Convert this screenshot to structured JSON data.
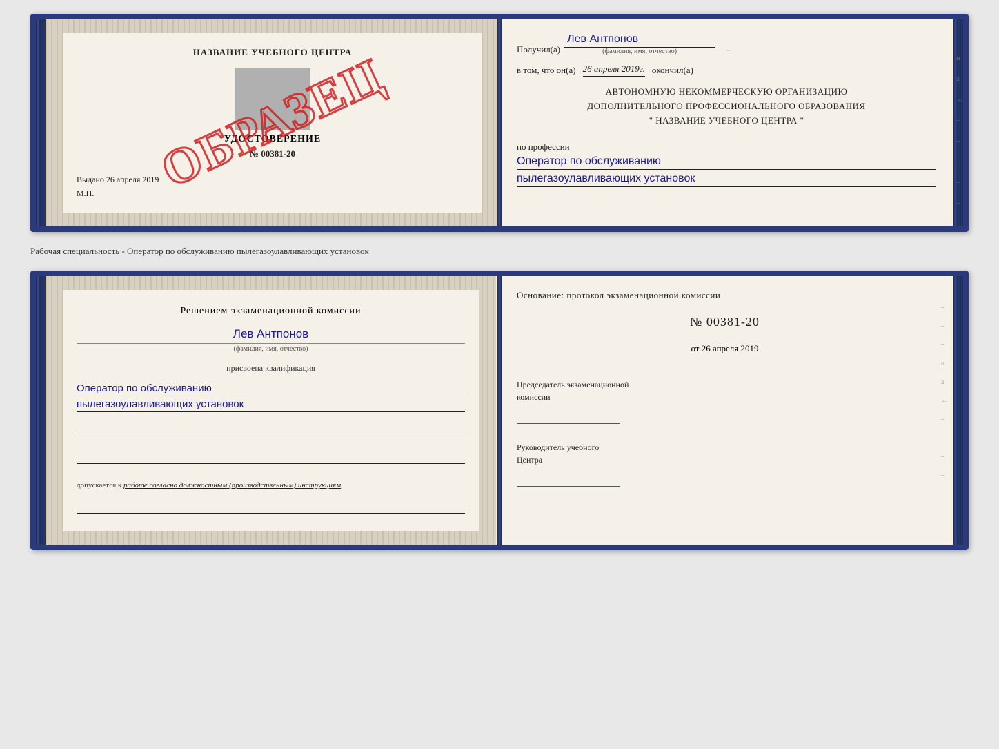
{
  "top_certificate": {
    "left": {
      "school_name": "НАЗВАНИЕ УЧЕБНОГО ЦЕНТРА",
      "cert_title": "УДОСТОВЕРЕНИЕ",
      "cert_number": "№ 00381-20",
      "issued_label": "Выдано",
      "issued_date": "26 апреля 2019",
      "mp_label": "М.П.",
      "obrazec": "ОБРАЗЕЦ"
    },
    "right": {
      "received_label": "Получил(а)",
      "recipient_name": "Лев Антпонов",
      "fio_label": "(фамилия, имя, отчество)",
      "completed_label": "в том, что он(а)",
      "completion_date": "26 апреля 2019г.",
      "completed_word": "окончил(а)",
      "org_line1": "АВТОНОМНУЮ НЕКОММЕРЧЕСКУЮ ОРГАНИЗАЦИЮ",
      "org_line2": "ДОПОЛНИТЕЛЬНОГО ПРОФЕССИОНАЛЬНОГО ОБРАЗОВАНИЯ",
      "org_line3": "\"  НАЗВАНИЕ УЧЕБНОГО ЦЕНТРА  \"",
      "side_mark1": "и",
      "side_mark2": "а",
      "side_mark3": "←",
      "profession_label": "по профессии",
      "profession_line1": "Оператор по обслуживанию",
      "profession_line2": "пылегазоулавливающих установок"
    }
  },
  "spacing_text": "Рабочая специальность - Оператор по обслуживанию пылегазоулавливающих установок",
  "bottom_certificate": {
    "left": {
      "decision_text": "Решением экзаменационной комиссии",
      "person_name": "Лев Антпонов",
      "fio_label": "(фамилия, имя, отчество)",
      "qualification_assigned": "присвоена квалификация",
      "qualification_line1": "Оператор по обслуживанию",
      "qualification_line2": "пылегазоулавливающих установок",
      "допускается_label": "допускается к",
      "допускается_value": "работе согласно должностным (производственным) инструкциям"
    },
    "right": {
      "osnование_label": "Основание: протокол экзаменационной комиссии",
      "protocol_number": "№  00381-20",
      "protocol_date_prefix": "от",
      "protocol_date": "26 апреля 2019",
      "chairman_label_line1": "Председатель экзаменационной",
      "chairman_label_line2": "комиссии",
      "head_label_line1": "Руководитель учебного",
      "head_label_line2": "Центра",
      "side_mark1": "и",
      "side_mark2": "а",
      "side_mark3": "←"
    }
  }
}
